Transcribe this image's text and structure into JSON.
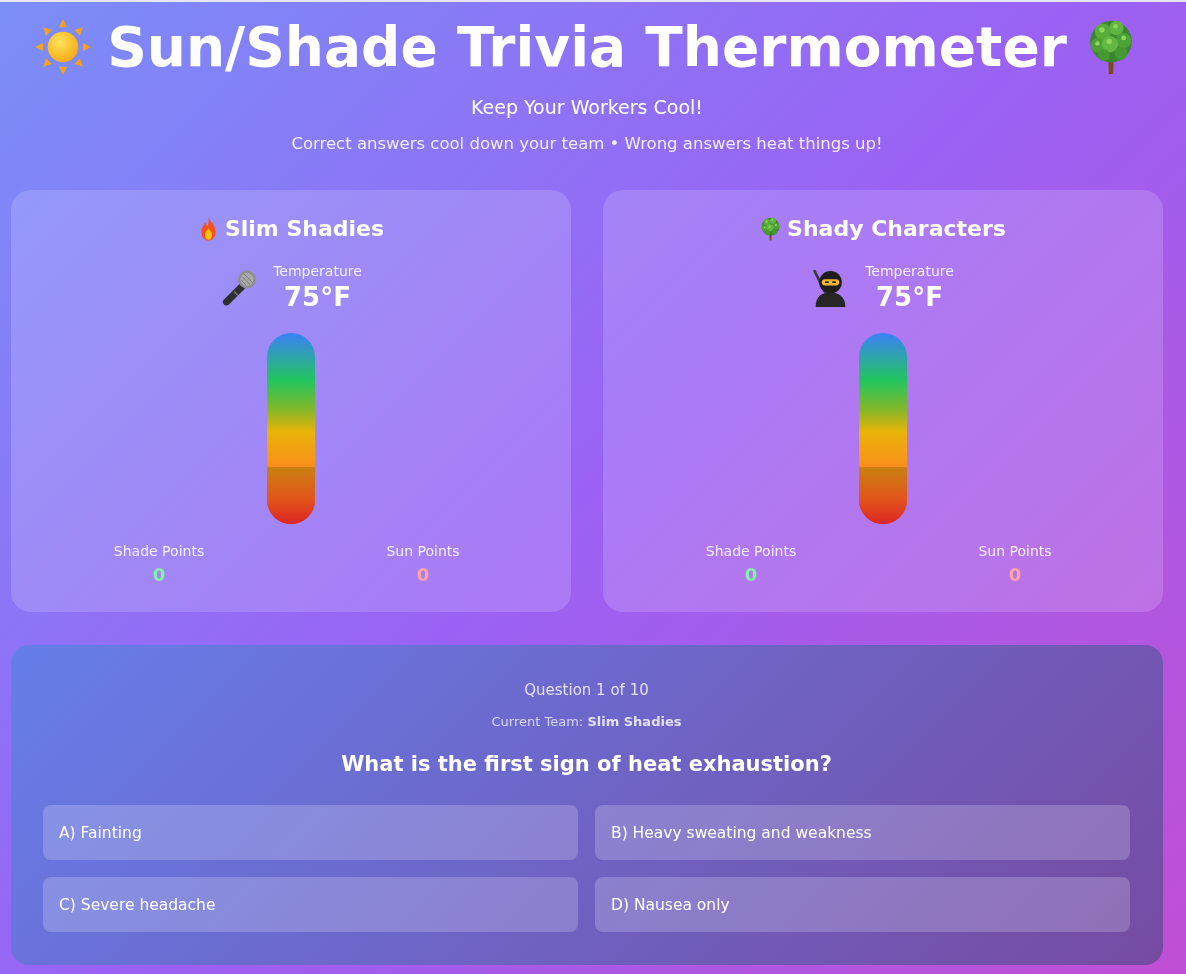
{
  "header": {
    "title": "Sun/Shade Trivia Thermometer",
    "subtitle": "Keep Your Workers Cool!",
    "tagline": "Correct answers cool down your team • Wrong answers heat things up!"
  },
  "teams": [
    {
      "name": "Slim Shadies",
      "temperature_label": "Temperature",
      "temperature": "75°F",
      "level": 0.3,
      "shade_label": "Shade Points",
      "shade_points": "0",
      "sun_label": "Sun Points",
      "sun_points": "0"
    },
    {
      "name": "Shady Characters",
      "temperature_label": "Temperature",
      "temperature": "75°F",
      "level": 0.3,
      "shade_label": "Shade Points",
      "shade_points": "0",
      "sun_label": "Sun Points",
      "sun_points": "0"
    }
  ],
  "quiz": {
    "progress": "Question 1 of 10",
    "current_team": "Current Team: **Slim Shadies**",
    "question": "What is the first sign of heat exhaustion?",
    "answers": [
      {
        "label": "A) Fainting",
        "selected": false
      },
      {
        "label": "B) Heavy sweating and weakness",
        "selected": false
      },
      {
        "label": "C) Severe headache",
        "selected": false
      },
      {
        "label": "D) Nausea only",
        "selected": false
      }
    ]
  }
}
